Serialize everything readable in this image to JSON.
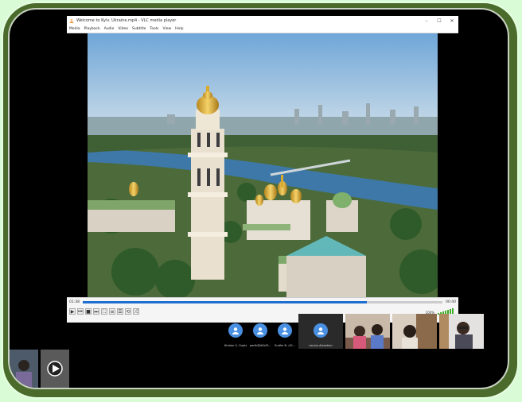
{
  "window": {
    "title": "Welcome to Kyiv. Ukraine.mp4 - VLC media player",
    "minimize": "–",
    "maximize": "☐",
    "close": "✕"
  },
  "menu": [
    "Media",
    "Playback",
    "Audio",
    "Video",
    "Subtitle",
    "Tools",
    "View",
    "Help"
  ],
  "player": {
    "elapsed": "01:38",
    "remaining": "00:40",
    "progress": 0.79,
    "volume": "100%"
  },
  "participants": [
    {
      "name": "Kirsten U. Gupta"
    },
    {
      "name": "parth@d3e5f..."
    },
    {
      "name": "Sudhir N. (Ol..."
    },
    {
      "name": "vanina Aleantian"
    }
  ],
  "colors": {
    "accent": "#1e6fd0",
    "avatar": "#4a90e2",
    "frame": "#4a6b2c",
    "background": "#d9fbd6"
  }
}
